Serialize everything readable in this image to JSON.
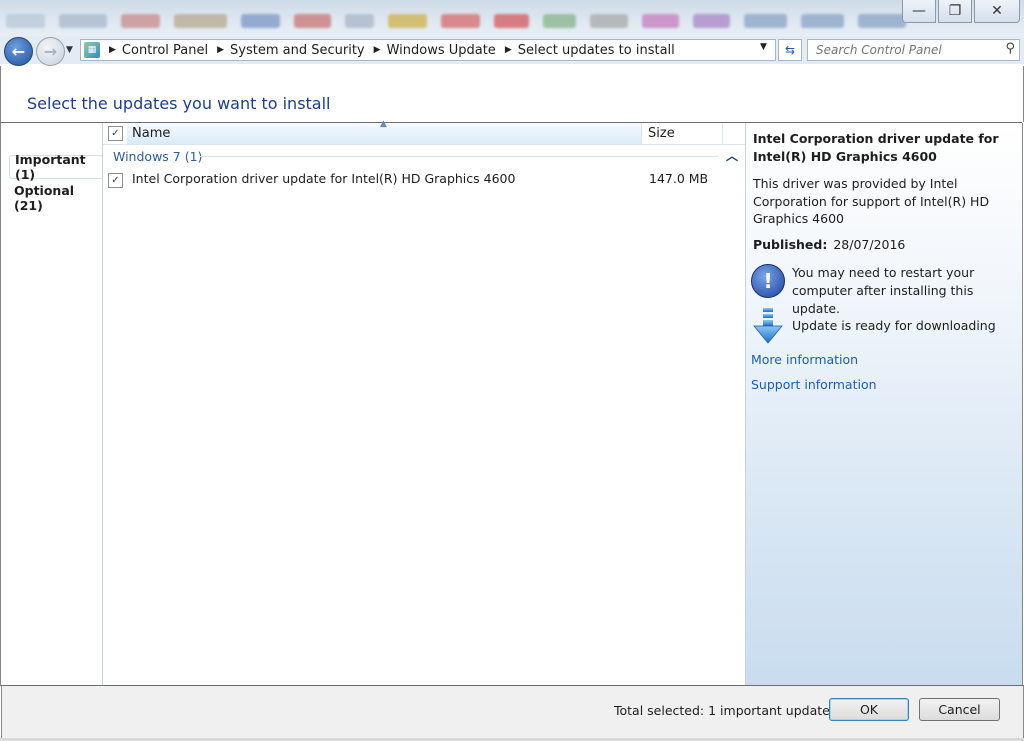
{
  "window": {
    "minimize": "—",
    "maximize": "❐",
    "close": "✕"
  },
  "breadcrumb": {
    "items": [
      "Control Panel",
      "System and Security",
      "Windows Update",
      "Select updates to install"
    ]
  },
  "search": {
    "placeholder": "Search Control Panel"
  },
  "page": {
    "title": "Select the updates you want to install"
  },
  "tabs": {
    "important": "Important (1)",
    "optional": "Optional (21)"
  },
  "list": {
    "columns": {
      "name": "Name",
      "size": "Size"
    },
    "group": "Windows 7 (1)",
    "rows": [
      {
        "name": "Intel Corporation driver update for Intel(R) HD Graphics 4600",
        "size": "147.0 MB",
        "checked": true
      }
    ]
  },
  "details": {
    "title": "Intel Corporation driver update for Intel(R) HD Graphics 4600",
    "description": "This driver was provided by Intel Corporation for support of Intel(R) HD Graphics 4600",
    "published_label": "Published:",
    "published_value": "28/07/2016",
    "restart_note": "You may need to restart your computer after installing this update.",
    "ready_note": "Update is ready for downloading",
    "more_info": "More information",
    "support_info": "Support information"
  },
  "footer": {
    "total": "Total selected: 1 important update",
    "ok": "OK",
    "cancel": "Cancel"
  },
  "colors": {
    "heading": "#1e3f87",
    "link": "#1f5eab",
    "group": "#2e5d9a"
  }
}
